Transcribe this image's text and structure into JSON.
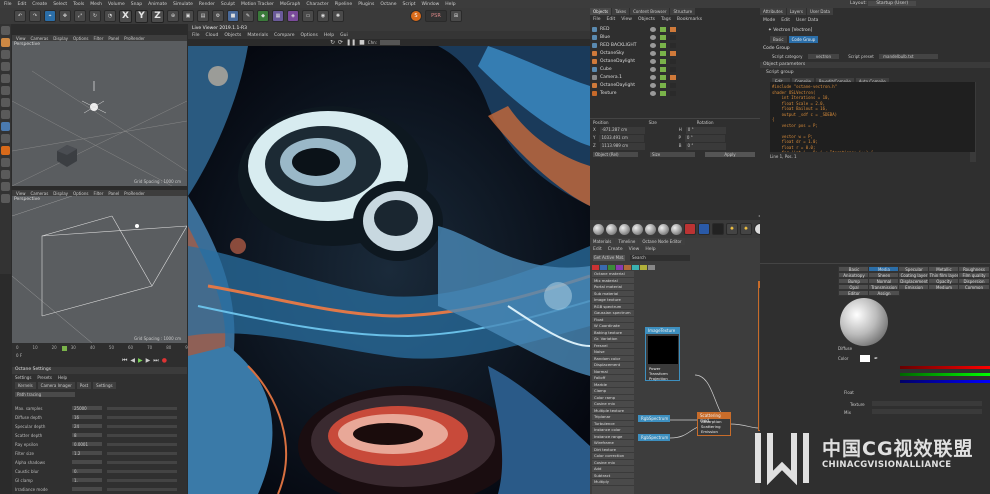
{
  "menubar": [
    "File",
    "Edit",
    "Create",
    "Select",
    "Tools",
    "Mesh",
    "Volume",
    "Snap",
    "Animate",
    "Simulate",
    "Render",
    "Sculpt",
    "Motion Tracker",
    "MoGraph",
    "Character",
    "Pipeline",
    "Plugins",
    "Octane",
    "Script",
    "Window",
    "Help"
  ],
  "layout": {
    "label": "Layout:",
    "value": "Startup (User)"
  },
  "toolbar": {
    "x": "X",
    "y": "Y",
    "z": "Z"
  },
  "viewport_top": {
    "menu": [
      "View",
      "Cameras",
      "Display",
      "Options",
      "Filter",
      "Panel",
      "ProRender"
    ],
    "title": "Perspective",
    "grid": "Grid Spacing : 1000 cm"
  },
  "viewport_bottom": {
    "menu": [
      "View",
      "Cameras",
      "Display",
      "Options",
      "Filter",
      "Panel",
      "ProRender"
    ],
    "title": "Perspective",
    "grid": "Grid Spacing : 1000 cm"
  },
  "timeline": {
    "ticks": [
      "0",
      "10",
      "20",
      "30",
      "40",
      "50",
      "60",
      "70",
      "80",
      "90",
      "10"
    ],
    "frame": "0 F"
  },
  "octane_settings": {
    "title": "Octane Settings",
    "menu": [
      "Settings",
      "Presets",
      "Help"
    ],
    "tabs": [
      "Kernels",
      "Camera Imager",
      "Post",
      "Settings"
    ],
    "kernel": "Path tracing",
    "rows": [
      {
        "label": "Max. samples",
        "value": "25000"
      },
      {
        "label": "Diffuse depth",
        "value": "16"
      },
      {
        "label": "Specular depth",
        "value": "24"
      },
      {
        "label": "Scatter depth",
        "value": "8"
      },
      {
        "label": "Ray epsilon",
        "value": "0.0001"
      },
      {
        "label": "Filter size",
        "value": "1.2"
      },
      {
        "label": "Alpha shadows",
        "value": ""
      },
      {
        "label": "Caustic blur",
        "value": "0."
      },
      {
        "label": "GI clamp",
        "value": "1."
      },
      {
        "label": "Irradiance mode",
        "value": ""
      }
    ]
  },
  "render_viewer": {
    "title": "Live Viewer 2019.1.1-R3",
    "menu": [
      "File",
      "Cloud",
      "Objects",
      "Materials",
      "Compare",
      "Options",
      "Help",
      "Gui"
    ],
    "channel": "Chn: "
  },
  "objects": {
    "tabs": [
      "Objects",
      "Takes",
      "Content Browser",
      "Structure"
    ],
    "menu": [
      "File",
      "Edit",
      "View",
      "Objects",
      "Tags",
      "Bookmarks"
    ],
    "items": [
      "RED",
      "Blue",
      "RED BACKLIGHT",
      "OctaneSky",
      "OctaneDaylight",
      "Cube",
      "Camera.1",
      "OctaneDaylight",
      "Texture"
    ],
    "coords": {
      "headers": [
        "Position",
        "Size",
        "Rotation"
      ],
      "rows": [
        [
          "X",
          "-871.287 cm",
          "H",
          "0 °"
        ],
        [
          "Y",
          "1033.491 cm",
          "P",
          "0 °"
        ],
        [
          "Z",
          "1113.989 cm",
          "B",
          "0 °"
        ]
      ],
      "mode": "Object (Rel)",
      "size_mode": "Size",
      "apply": "Apply"
    }
  },
  "node_editor": {
    "tabs": [
      "Materials",
      "Timeline",
      "Octane Node Editor"
    ],
    "menu": [
      "Edit",
      "Create",
      "View",
      "Help"
    ],
    "search_label": "Get Active Mat.",
    "search": "Search",
    "list": [
      "Octane material",
      "Mix material",
      "Portal material",
      "Sub material",
      "Image texture",
      "RGB spectrum",
      "Gaussian spectrum",
      "Float",
      "W Coordinate",
      "Baking texture",
      "Gr. Variation",
      "Fresnel",
      "Noise",
      "Random color",
      "Displacement",
      "Normal",
      "Falloff",
      "Marble",
      "Clamp",
      "Color ramp",
      "Cosine mix",
      "Multiple texture",
      "Triplanar",
      "Turbulence",
      "Instance color",
      "Instance range",
      "Wireframe",
      "Dirt texture",
      "Color correction",
      "Cosine mix",
      "Add",
      "Subtract",
      "Multiply"
    ],
    "nodes": {
      "image": {
        "title": "ImageTexture",
        "ports": [
          "Power",
          "Transform",
          "Projection"
        ]
      },
      "spec1": {
        "title": "RgbSpectrum"
      },
      "spec2": {
        "title": "RgbSpectrum"
      },
      "scatter": {
        "title": "Scattering med.",
        "ports": [
          "Absorption",
          "Scattering",
          "Emission"
        ]
      },
      "composite": {
        "title": "Composite",
        "ports": [
          "Albedo",
          "Specular",
          "Roughness",
          "Metallic",
          "Film width",
          "Bump",
          "Normal",
          "Displacement",
          "Opacity",
          "Transmission",
          "Edges rounding"
        ]
      }
    }
  },
  "attributes": {
    "tabs": [
      "Attributes",
      "Layers",
      "User Data"
    ],
    "menu": [
      "Mode",
      "Edit",
      "User Data"
    ],
    "object": "Vectron [Vectron]",
    "subtabs": [
      "Basic",
      "Code Group"
    ],
    "group": "Code Group",
    "script_category": {
      "label": "Script category",
      "value": "vectron"
    },
    "script_preset": {
      "label": "Script preset",
      "value": "mandelbulb.txt"
    },
    "params": "Object parameters",
    "script_group": "Script group",
    "buttons": [
      "Edit...",
      "Compile",
      "Re-edit/Compile",
      "Auto Compile"
    ],
    "code": "#include \"octane-vectron.h\"\nshader OSLVectron(\n    int Iterations = 10,\n    float Scale = 2.0,\n    float Bailout = 16,\n    output _sdf c = _SDEBA)\n{\n    vector pos = P;\n\n    vector w = P;\n    float dr = 1.0;\n    float r = 0.0;\n    for (int i = 0; i < Iterations; i++) {\n      r = length(w);",
    "status": "Line 1, Pos. 1",
    "mat_tabs": [
      "Basic",
      "Media",
      "Specular",
      "Metallic",
      "Roughness",
      "Anisotropy",
      "Sheen",
      "Coating layer",
      "Thin film layer",
      "Film quality",
      "Bump",
      "Normal",
      "Displacement",
      "Opacity",
      "Dispersion",
      "Opal",
      "Transmission",
      "Emission",
      "Medium",
      "Common",
      "Editor",
      "Assign"
    ],
    "diffuse": "Diffuse",
    "color": "Color",
    "float": "Float",
    "texture": "Texture",
    "mix": "Mix"
  },
  "watermark": {
    "cn": "中国CG视效联盟",
    "en": "CHINACGVISIONALLIANCE"
  },
  "colors": {
    "accent": "#d98c3a",
    "node_orange": "#c86c2a",
    "node_blue": "#3d8fbf"
  }
}
